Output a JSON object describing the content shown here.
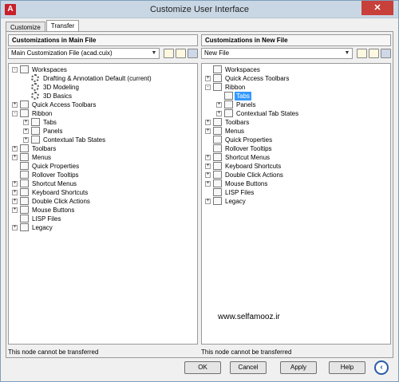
{
  "window": {
    "title": "Customize User Interface",
    "icon": "autocad-icon",
    "close_label": "✕"
  },
  "tabs": [
    {
      "label": "Customize"
    },
    {
      "label": "Transfer"
    }
  ],
  "left": {
    "header": "Customizations in Main File",
    "file_select": "Main Customization File (acad.cuix)",
    "status": "This node cannot be transferred",
    "tree": [
      {
        "label": "Workspaces",
        "depth": 0,
        "toggle": "-",
        "icon": "workspace-icon"
      },
      {
        "label": "Drafting & Annotation Default (current)",
        "depth": 1,
        "toggle": "",
        "icon": "gear-icon"
      },
      {
        "label": "3D Modeling",
        "depth": 1,
        "toggle": "",
        "icon": "gear-icon"
      },
      {
        "label": "3D Basics",
        "depth": 1,
        "toggle": "",
        "icon": "gear-icon"
      },
      {
        "label": "Quick Access Toolbars",
        "depth": 0,
        "toggle": "+",
        "icon": "toolbar-icon"
      },
      {
        "label": "Ribbon",
        "depth": 0,
        "toggle": "-",
        "icon": "ribbon-icon"
      },
      {
        "label": "Tabs",
        "depth": 1,
        "toggle": "+",
        "icon": "tabs-icon"
      },
      {
        "label": "Panels",
        "depth": 1,
        "toggle": "+",
        "icon": "panels-icon"
      },
      {
        "label": "Contextual Tab States",
        "depth": 1,
        "toggle": "+",
        "icon": "contextual-icon"
      },
      {
        "label": "Toolbars",
        "depth": 0,
        "toggle": "+",
        "icon": "toolbar-icon"
      },
      {
        "label": "Menus",
        "depth": 0,
        "toggle": "+",
        "icon": "menu-icon"
      },
      {
        "label": "Quick Properties",
        "depth": 0,
        "toggle": "",
        "icon": "properties-icon"
      },
      {
        "label": "Rollover Tooltips",
        "depth": 0,
        "toggle": "",
        "icon": "tooltip-icon"
      },
      {
        "label": "Shortcut Menus",
        "depth": 0,
        "toggle": "+",
        "icon": "menu-icon"
      },
      {
        "label": "Keyboard Shortcuts",
        "depth": 0,
        "toggle": "+",
        "icon": "keyboard-icon"
      },
      {
        "label": "Double Click Actions",
        "depth": 0,
        "toggle": "+",
        "icon": "doubleclick-icon"
      },
      {
        "label": "Mouse Buttons",
        "depth": 0,
        "toggle": "+",
        "icon": "mouse-icon"
      },
      {
        "label": "LISP Files",
        "depth": 0,
        "toggle": "",
        "icon": "lisp-icon"
      },
      {
        "label": "Legacy",
        "depth": 0,
        "toggle": "+",
        "icon": "legacy-icon"
      }
    ]
  },
  "right": {
    "header": "Customizations in New File",
    "file_select": "New File",
    "status": "This node cannot be transferred",
    "tree": [
      {
        "label": "Workspaces",
        "depth": 0,
        "toggle": "",
        "icon": "workspace-icon"
      },
      {
        "label": "Quick Access Toolbars",
        "depth": 0,
        "toggle": "+",
        "icon": "toolbar-icon"
      },
      {
        "label": "Ribbon",
        "depth": 0,
        "toggle": "-",
        "icon": "ribbon-icon"
      },
      {
        "label": "Tabs",
        "depth": 1,
        "toggle": "",
        "icon": "tabs-icon",
        "selected": true
      },
      {
        "label": "Panels",
        "depth": 1,
        "toggle": "+",
        "icon": "panels-icon"
      },
      {
        "label": "Contextual Tab States",
        "depth": 1,
        "toggle": "+",
        "icon": "contextual-icon"
      },
      {
        "label": "Toolbars",
        "depth": 0,
        "toggle": "+",
        "icon": "toolbar-icon"
      },
      {
        "label": "Menus",
        "depth": 0,
        "toggle": "+",
        "icon": "menu-icon"
      },
      {
        "label": "Quick Properties",
        "depth": 0,
        "toggle": "",
        "icon": "properties-icon"
      },
      {
        "label": "Rollover Tooltips",
        "depth": 0,
        "toggle": "",
        "icon": "tooltip-icon"
      },
      {
        "label": "Shortcut Menus",
        "depth": 0,
        "toggle": "+",
        "icon": "menu-icon"
      },
      {
        "label": "Keyboard Shortcuts",
        "depth": 0,
        "toggle": "+",
        "icon": "keyboard-icon"
      },
      {
        "label": "Double Click Actions",
        "depth": 0,
        "toggle": "+",
        "icon": "doubleclick-icon"
      },
      {
        "label": "Mouse Buttons",
        "depth": 0,
        "toggle": "+",
        "icon": "mouse-icon"
      },
      {
        "label": "LISP Files",
        "depth": 0,
        "toggle": "",
        "icon": "lisp-icon"
      },
      {
        "label": "Legacy",
        "depth": 0,
        "toggle": "+",
        "icon": "legacy-icon"
      }
    ]
  },
  "watermark": "www.selfamooz.ir",
  "buttons": {
    "ok": "OK",
    "cancel": "Cancel",
    "apply": "Apply",
    "help": "Help"
  }
}
